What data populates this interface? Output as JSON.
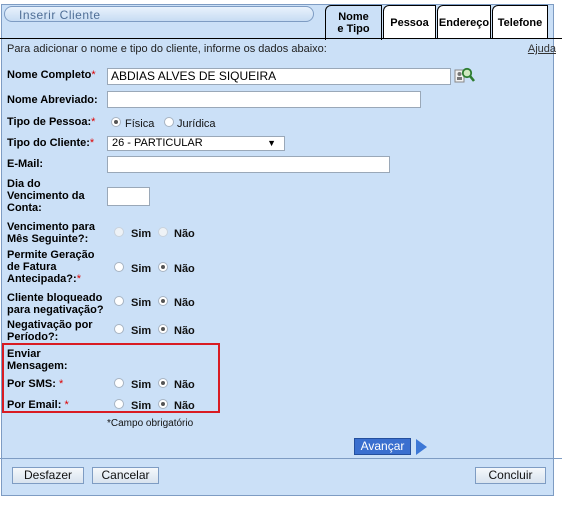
{
  "window": {
    "title": "Inserir Cliente"
  },
  "tabs": [
    {
      "label": "Nome e Tipo"
    },
    {
      "label": "Pessoa"
    },
    {
      "label": "Endereço"
    },
    {
      "label": "Telefone"
    }
  ],
  "intro_text": "Para adicionar o nome e tipo do cliente, informe os dados abaixo:",
  "help_link": "Ajuda",
  "fields": {
    "nome_completo": {
      "label": "Nome Completo",
      "required": "*",
      "value": "ABDIAS ALVES DE SIQUEIRA"
    },
    "nome_abreviado": {
      "label": "Nome Abreviado:",
      "value": ""
    },
    "tipo_pessoa": {
      "label": "Tipo de Pessoa:",
      "required": "*",
      "options": [
        "Física",
        "Jurídica"
      ],
      "selected": "Física"
    },
    "tipo_cliente": {
      "label": "Tipo do Cliente:",
      "required": "*",
      "value": "26 - PARTICULAR"
    },
    "email": {
      "label": "E-Mail:",
      "value": ""
    },
    "dia_vencimento": {
      "label": "Dia do Vencimento da Conta:",
      "value": ""
    },
    "venc_mes_seguinte": {
      "label": "Vencimento para Mês Seguinte?:",
      "options": [
        "Sim",
        "Não"
      ],
      "selected": "",
      "disabled": true
    },
    "geracao_fatura": {
      "label": "Permite Geração de Fatura Antecipada?:",
      "required": "*",
      "options": [
        "Sim",
        "Não"
      ],
      "selected": "Não"
    },
    "cliente_bloqueado": {
      "label": "Cliente bloqueado para negativação?",
      "options": [
        "Sim",
        "Não"
      ],
      "selected": "Não"
    },
    "negativacao_periodo": {
      "label": "Negativação por Período?:",
      "options": [
        "Sim",
        "Não"
      ],
      "selected": "Não"
    },
    "enviar_mensagem": {
      "label": "Enviar Mensagem:"
    },
    "por_sms": {
      "label": "Por SMS:",
      "required": "*",
      "options": [
        "Sim",
        "Não"
      ],
      "selected": "Não"
    },
    "por_email": {
      "label": "Por Email:",
      "required": "*",
      "options": [
        "Sim",
        "Não"
      ],
      "selected": "Não"
    }
  },
  "required_note": "*Campo obrigatório",
  "buttons": {
    "avancar": "Avançar",
    "desfazer": "Desfazer",
    "cancelar": "Cancelar",
    "concluir": "Concluir"
  },
  "icons": {
    "search": "magnifier-person-icon",
    "next": "arrow-right-icon",
    "select_arrow": "dropdown-arrow-icon"
  },
  "colors": {
    "panel_bg": "#cbe0f7",
    "highlight_border": "#d91c23",
    "required": "#dd0000",
    "primary_button": "#3a6fcf"
  }
}
